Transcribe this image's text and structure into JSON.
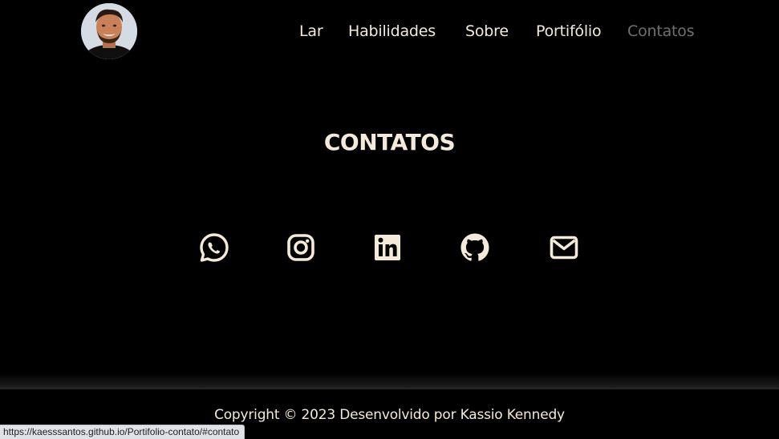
{
  "header": {
    "avatar_icon": "profile-photo",
    "nav": [
      {
        "label": "Lar",
        "active": false
      },
      {
        "label": "Habilidades",
        "active": false
      },
      {
        "label": "Sobre",
        "active": false
      },
      {
        "label": "Portifólio",
        "active": false
      },
      {
        "label": "Contatos",
        "active": true
      }
    ]
  },
  "contacts": {
    "title": "CONTATOS",
    "icons": [
      "whatsapp-icon",
      "instagram-icon",
      "linkedin-icon",
      "github-icon",
      "email-icon"
    ]
  },
  "footer": {
    "copyright": "Copyright © 2023 Desenvolvido por Kassio Kennedy"
  },
  "status_bar": {
    "url": "https://kaesssantos.github.io/Portifolio-contato/#contato"
  },
  "colors": {
    "background": "#000000",
    "text": "#f3ead9",
    "active_nav": "#6f6f6f"
  }
}
